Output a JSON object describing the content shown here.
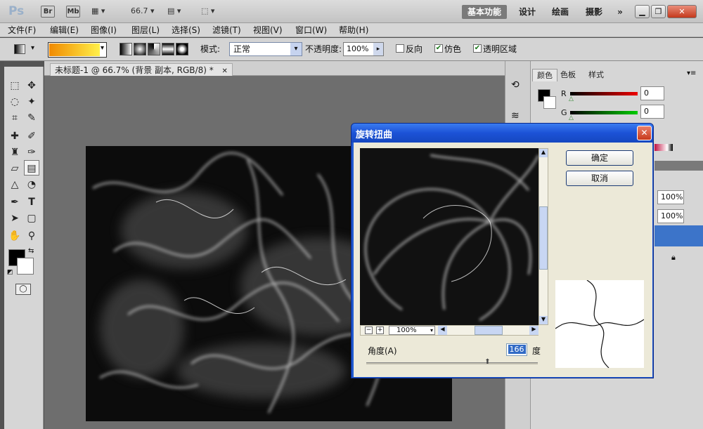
{
  "app": {
    "logo": "Ps",
    "bridge": "Br",
    "minibridge": "Mb",
    "zoom": "66.7",
    "workspaces": [
      "基本功能",
      "设计",
      "绘画",
      "摄影"
    ],
    "more": "»"
  },
  "menu": [
    "文件(F)",
    "编辑(E)",
    "图像(I)",
    "图层(L)",
    "选择(S)",
    "滤镜(T)",
    "视图(V)",
    "窗口(W)",
    "帮助(H)"
  ],
  "options": {
    "mode_label": "模式:",
    "mode_value": "正常",
    "opacity_label": "不透明度:",
    "opacity_value": "100%",
    "reverse_label": "反向",
    "dither_label": "仿色",
    "transparency_label": "透明区域",
    "reverse_checked": false,
    "dither_checked": true,
    "transparency_checked": true
  },
  "document": {
    "title": "未标题-1 @ 66.7% (背景 副本, RGB/8) *",
    "close": "✕"
  },
  "panels": {
    "tabs": [
      "颜色",
      "色板",
      "样式"
    ],
    "r_label": "R",
    "g_label": "G",
    "r_value": "0",
    "g_value": "0",
    "opacity1": "100%",
    "opacity2": "100%"
  },
  "dialog": {
    "title": "旋转扭曲",
    "ok": "确定",
    "cancel": "取消",
    "zoom": "100%",
    "angle_label": "角度(A)",
    "angle_value": "166",
    "angle_unit": "度",
    "angle_fraction": 0.71
  },
  "colors": {
    "accent": "#2059d0",
    "selection": "#3c74c9"
  }
}
